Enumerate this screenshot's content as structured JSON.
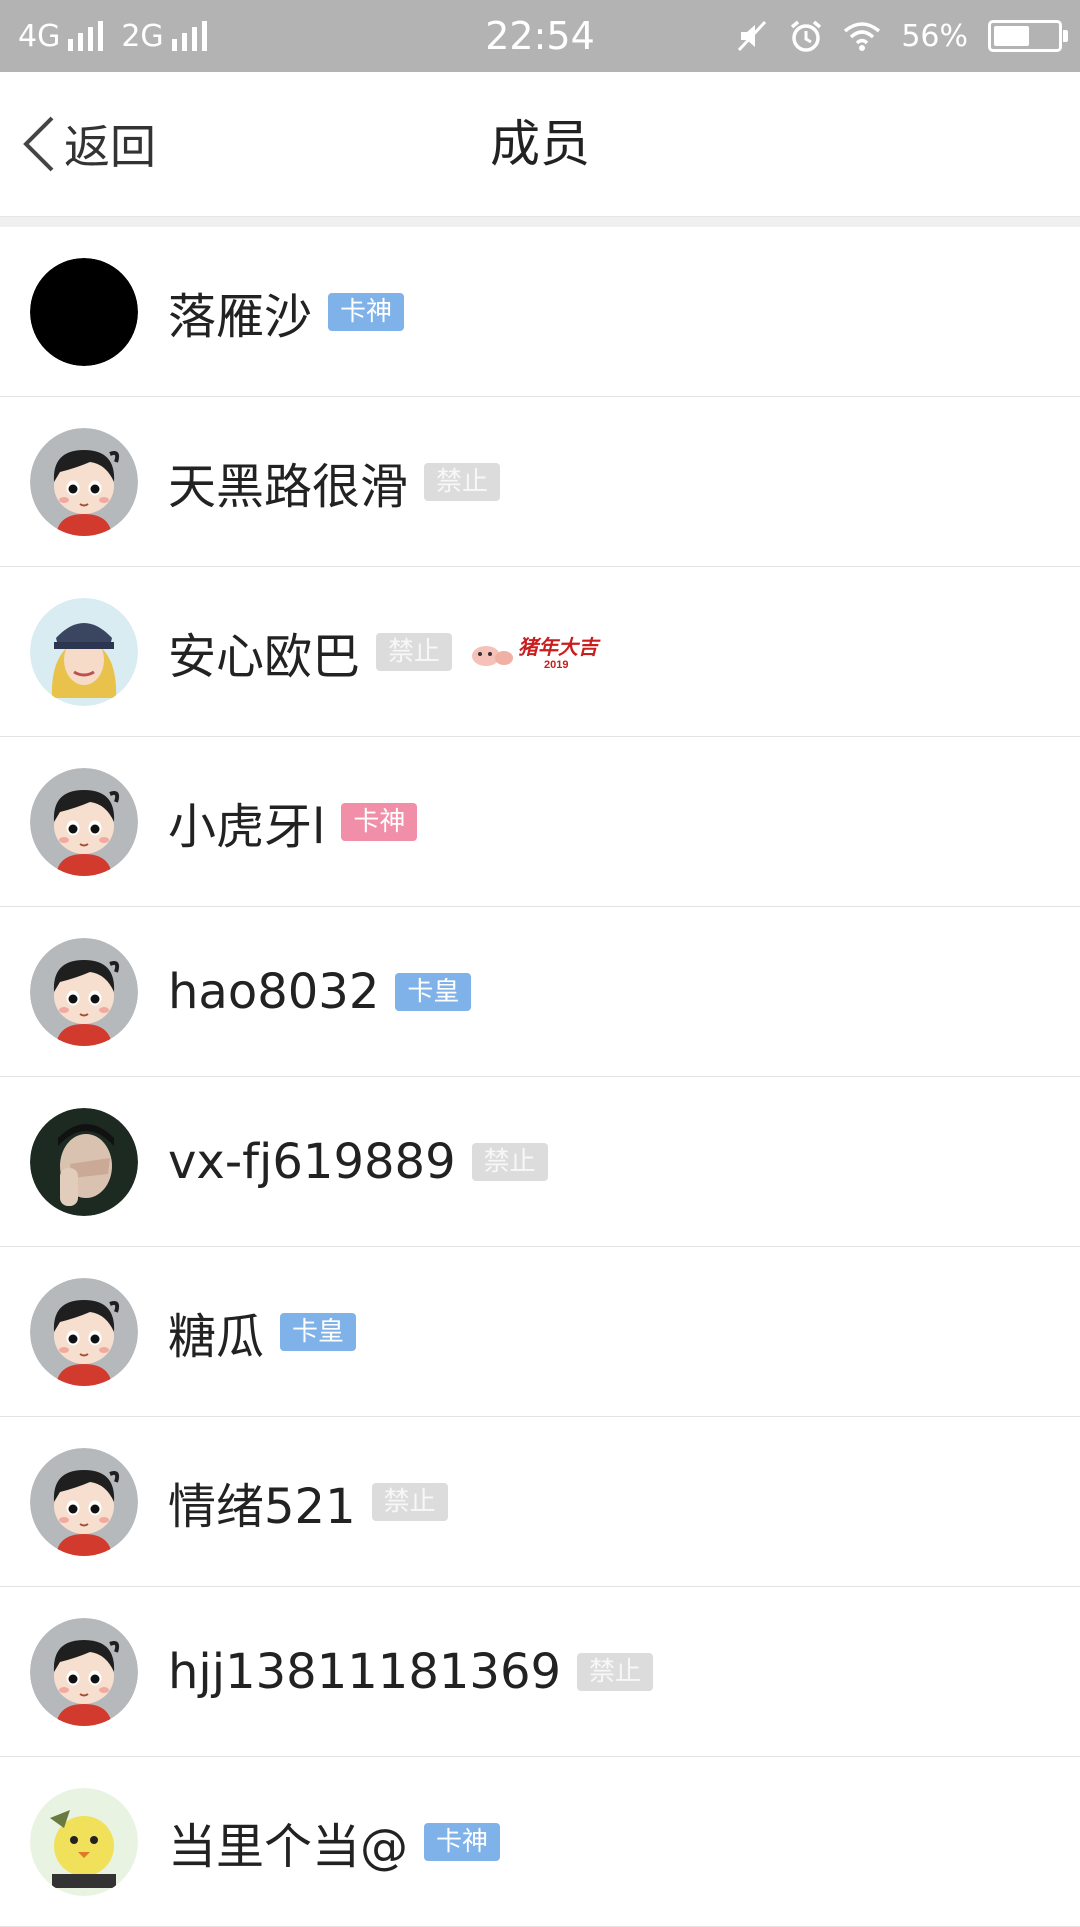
{
  "status_bar": {
    "network_1": "4G",
    "network_2": "2G",
    "time": "22:54",
    "battery": "56%",
    "battery_level": 0.56,
    "icons": [
      "signal-icon",
      "silent-icon",
      "alarm-icon",
      "wifi-icon",
      "battery-icon"
    ]
  },
  "nav": {
    "back_label": "返回",
    "title": "成员"
  },
  "colors": {
    "status_bar_bg": "#b3b3b3",
    "badge_blue": "#7fb2e8",
    "badge_pink": "#f08fa7",
    "badge_gray": "#dcdcdc"
  },
  "members": [
    {
      "name": "落雁沙",
      "badge": "卡神",
      "badge_style": "blue",
      "avatar": "black-avatar"
    },
    {
      "name": "天黑路很滑",
      "badge": "禁止",
      "badge_style": "gray",
      "avatar": "cartoon-boy-avatar"
    },
    {
      "name": "安心欧巴",
      "badge": "禁止",
      "badge_style": "gray",
      "avatar": "photo-girl-avatar",
      "sticker": "猪年大吉",
      "sticker_year": "2019"
    },
    {
      "name": "小虎牙l",
      "badge": "卡神",
      "badge_style": "pink",
      "avatar": "cartoon-boy-avatar"
    },
    {
      "name": "hao8032",
      "badge": "卡皇",
      "badge_style": "blue",
      "avatar": "cartoon-boy-avatar"
    },
    {
      "name": "vx-fj619889",
      "badge": "禁止",
      "badge_style": "gray",
      "avatar": "photo-man-avatar"
    },
    {
      "name": "糖瓜",
      "badge": "卡皇",
      "badge_style": "blue",
      "avatar": "cartoon-boy-avatar"
    },
    {
      "name": "情绪521",
      "badge": "禁止",
      "badge_style": "gray",
      "avatar": "cartoon-boy-avatar"
    },
    {
      "name": "hjj13811181369",
      "badge": "禁止",
      "badge_style": "gray",
      "avatar": "cartoon-boy-avatar"
    },
    {
      "name": "当里个当@",
      "badge": "卡神",
      "badge_style": "blue",
      "avatar": "cartoon-chick-avatar"
    }
  ]
}
